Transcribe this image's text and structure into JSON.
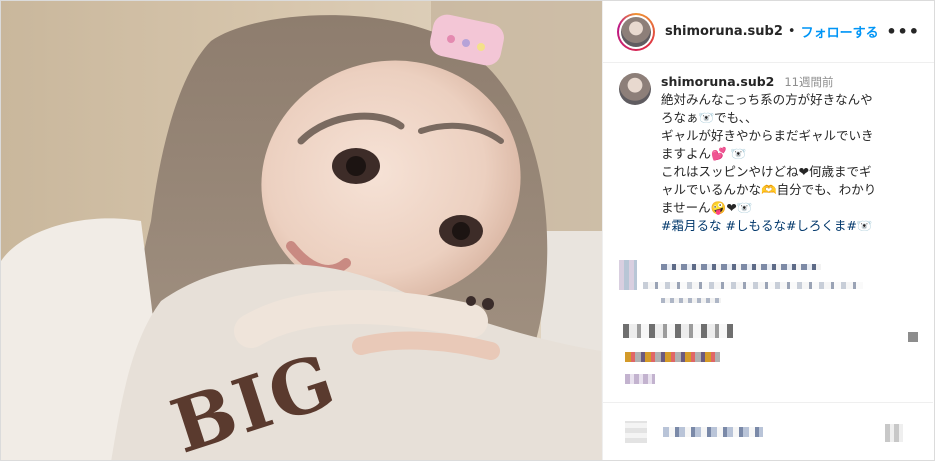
{
  "post": {
    "username": "shimoruna.sub2",
    "separator": "•",
    "follow_label": "フォローする",
    "more_label": "•••"
  },
  "caption": {
    "username": "shimoruna.sub2",
    "time": "11週間前",
    "lines": [
      "絶対みんなこっち系の方が好きなんや",
      "ろなぁ🐻‍❄️でも、、",
      "ギャルが好きやからまだギャルでいき",
      "ますよん💕 🐻‍❄️",
      "これはスッピンやけどね❤何歳までギ",
      "ャルでいるんかな🫶自分でも、わかり",
      "ませーん🤪❤🐻‍❄️"
    ],
    "hashtags": [
      "#霜月るな",
      "#しもるな",
      "#しろくま",
      "#🐻‍❄️"
    ]
  },
  "photo": {
    "sweater_text": "BIG"
  },
  "colors": {
    "follow": "#0095f6",
    "hashtag": "#00376b",
    "muted": "#8e8e8e"
  }
}
